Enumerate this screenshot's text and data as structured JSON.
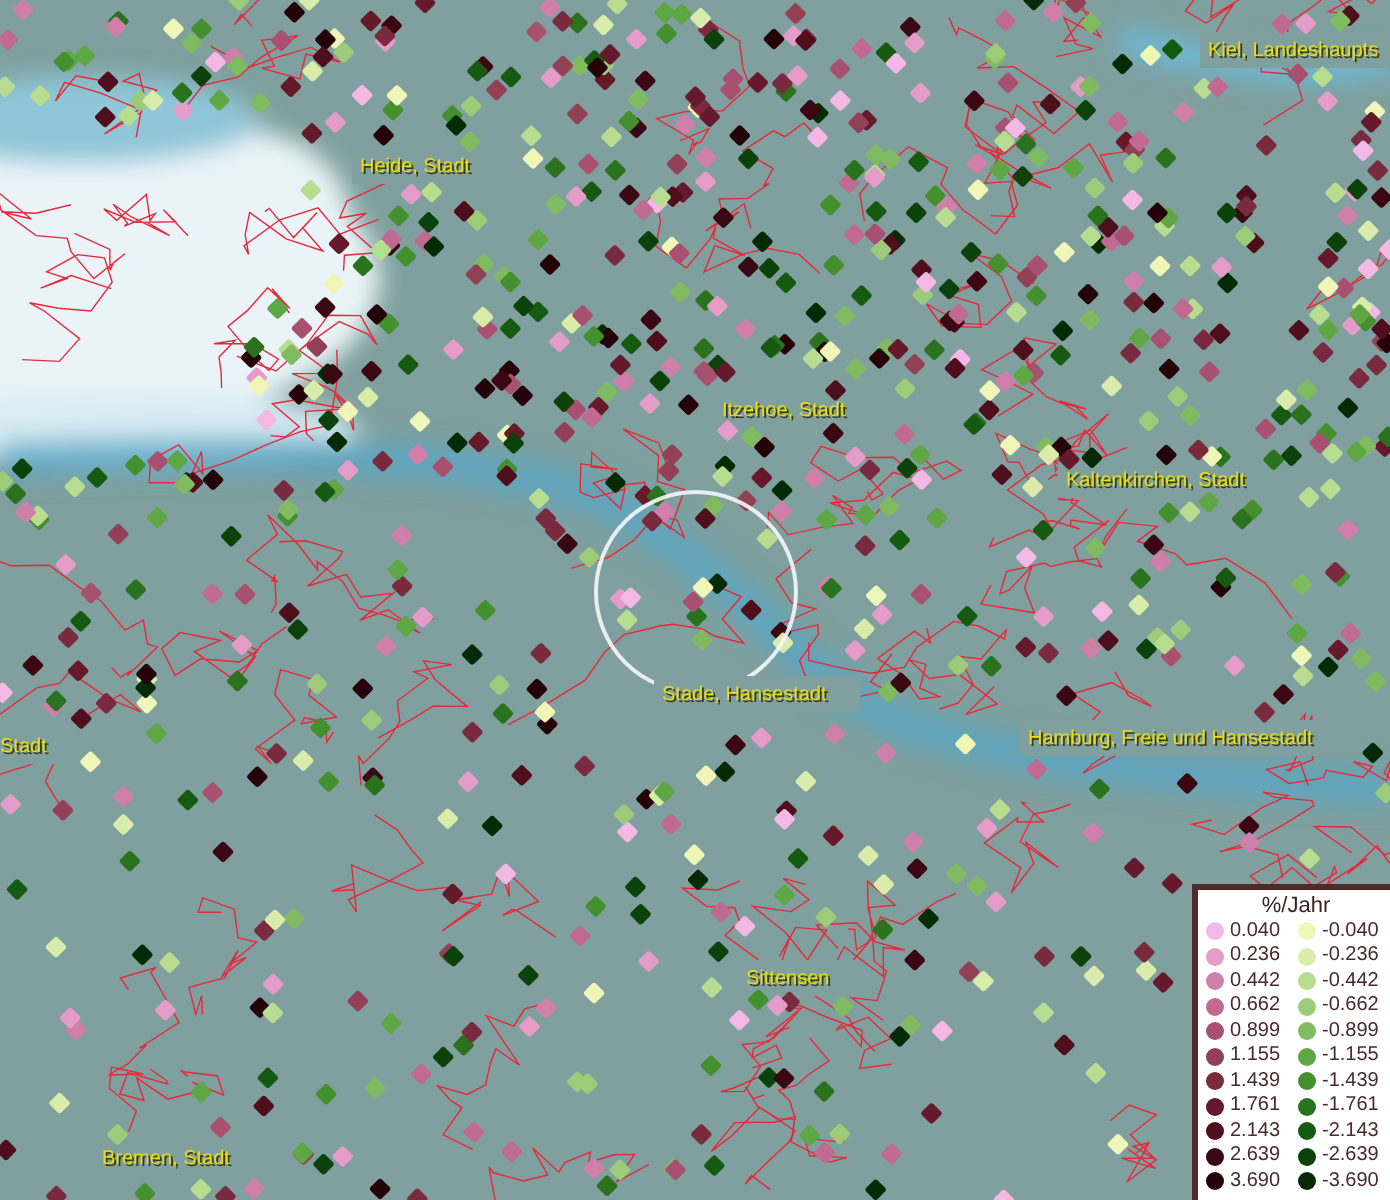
{
  "map": {
    "place_labels": [
      "Kiel, Landeshaupts",
      "Heide, Stadt",
      "Itzehoe, Stadt",
      "Kaltenkirchen, Stadt",
      "Stade, Hansestadt",
      "Stadt",
      "Hamburg, Freie und Hansestadt",
      "Sittensen",
      "Bremen, Stadt"
    ]
  },
  "legend": {
    "title": "%/Jahr",
    "entries": [
      {
        "label": "0.040",
        "color": "#f4b8e4"
      },
      {
        "label": "-0.040",
        "color": "#f0f5b8"
      },
      {
        "label": "0.236",
        "color": "#e59cc9"
      },
      {
        "label": "-0.236",
        "color": "#d9ecaa"
      },
      {
        "label": "0.442",
        "color": "#d07fab"
      },
      {
        "label": "-0.442",
        "color": "#b8dd90"
      },
      {
        "label": "0.662",
        "color": "#c06a92"
      },
      {
        "label": "-0.662",
        "color": "#9ccc7a"
      },
      {
        "label": "0.899",
        "color": "#a8506f"
      },
      {
        "label": "-0.899",
        "color": "#80bb62"
      },
      {
        "label": "1.155",
        "color": "#924056"
      },
      {
        "label": "-1.155",
        "color": "#5fa644"
      },
      {
        "label": "1.439",
        "color": "#7a2a3e"
      },
      {
        "label": "-1.439",
        "color": "#44902f"
      },
      {
        "label": "1.761",
        "color": "#65192a"
      },
      {
        "label": "-1.761",
        "color": "#2a721d"
      },
      {
        "label": "2.143",
        "color": "#4f0e1c"
      },
      {
        "label": "-2.143",
        "color": "#165a12"
      },
      {
        "label": "2.639",
        "color": "#3a0712"
      },
      {
        "label": "-2.639",
        "color": "#0b420b"
      },
      {
        "label": "3.690",
        "color": "#250409"
      },
      {
        "label": "-3.690",
        "color": "#062a06"
      }
    ]
  }
}
